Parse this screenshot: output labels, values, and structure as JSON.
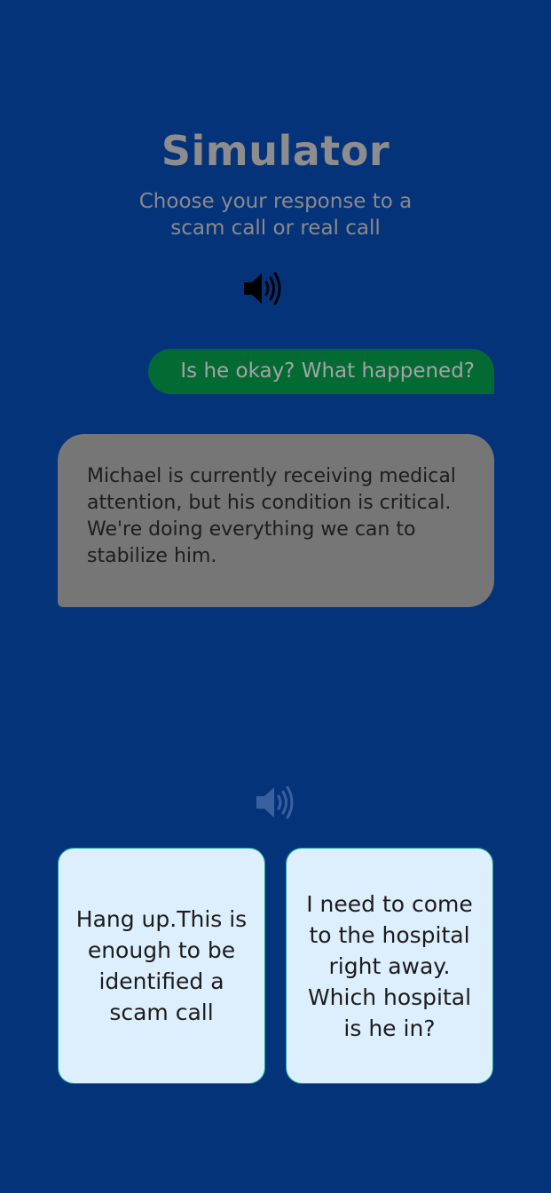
{
  "header": {
    "title": "Simulator",
    "subtitle": "Choose your response to a scam call or real call"
  },
  "icons": {
    "top_speaker": "speaker-volume-icon",
    "bottom_speaker": "speaker-volume-icon"
  },
  "conversation": {
    "user_message": "Is he okay? What happened?",
    "caller_message": "Michael is currently receiving medical attention, but his condition is critical. We're doing everything we can to stabilize him."
  },
  "choices": [
    {
      "label": "Hang up.This is enough to be identified a scam call"
    },
    {
      "label": "I need to come to the hospital right away. Which hospital is he in?"
    }
  ],
  "colors": {
    "background": "#05337a",
    "user_bubble": "#046a34",
    "caller_bubble": "#767676",
    "choice_card": "#ddeefd",
    "choice_border": "#18a79a"
  }
}
